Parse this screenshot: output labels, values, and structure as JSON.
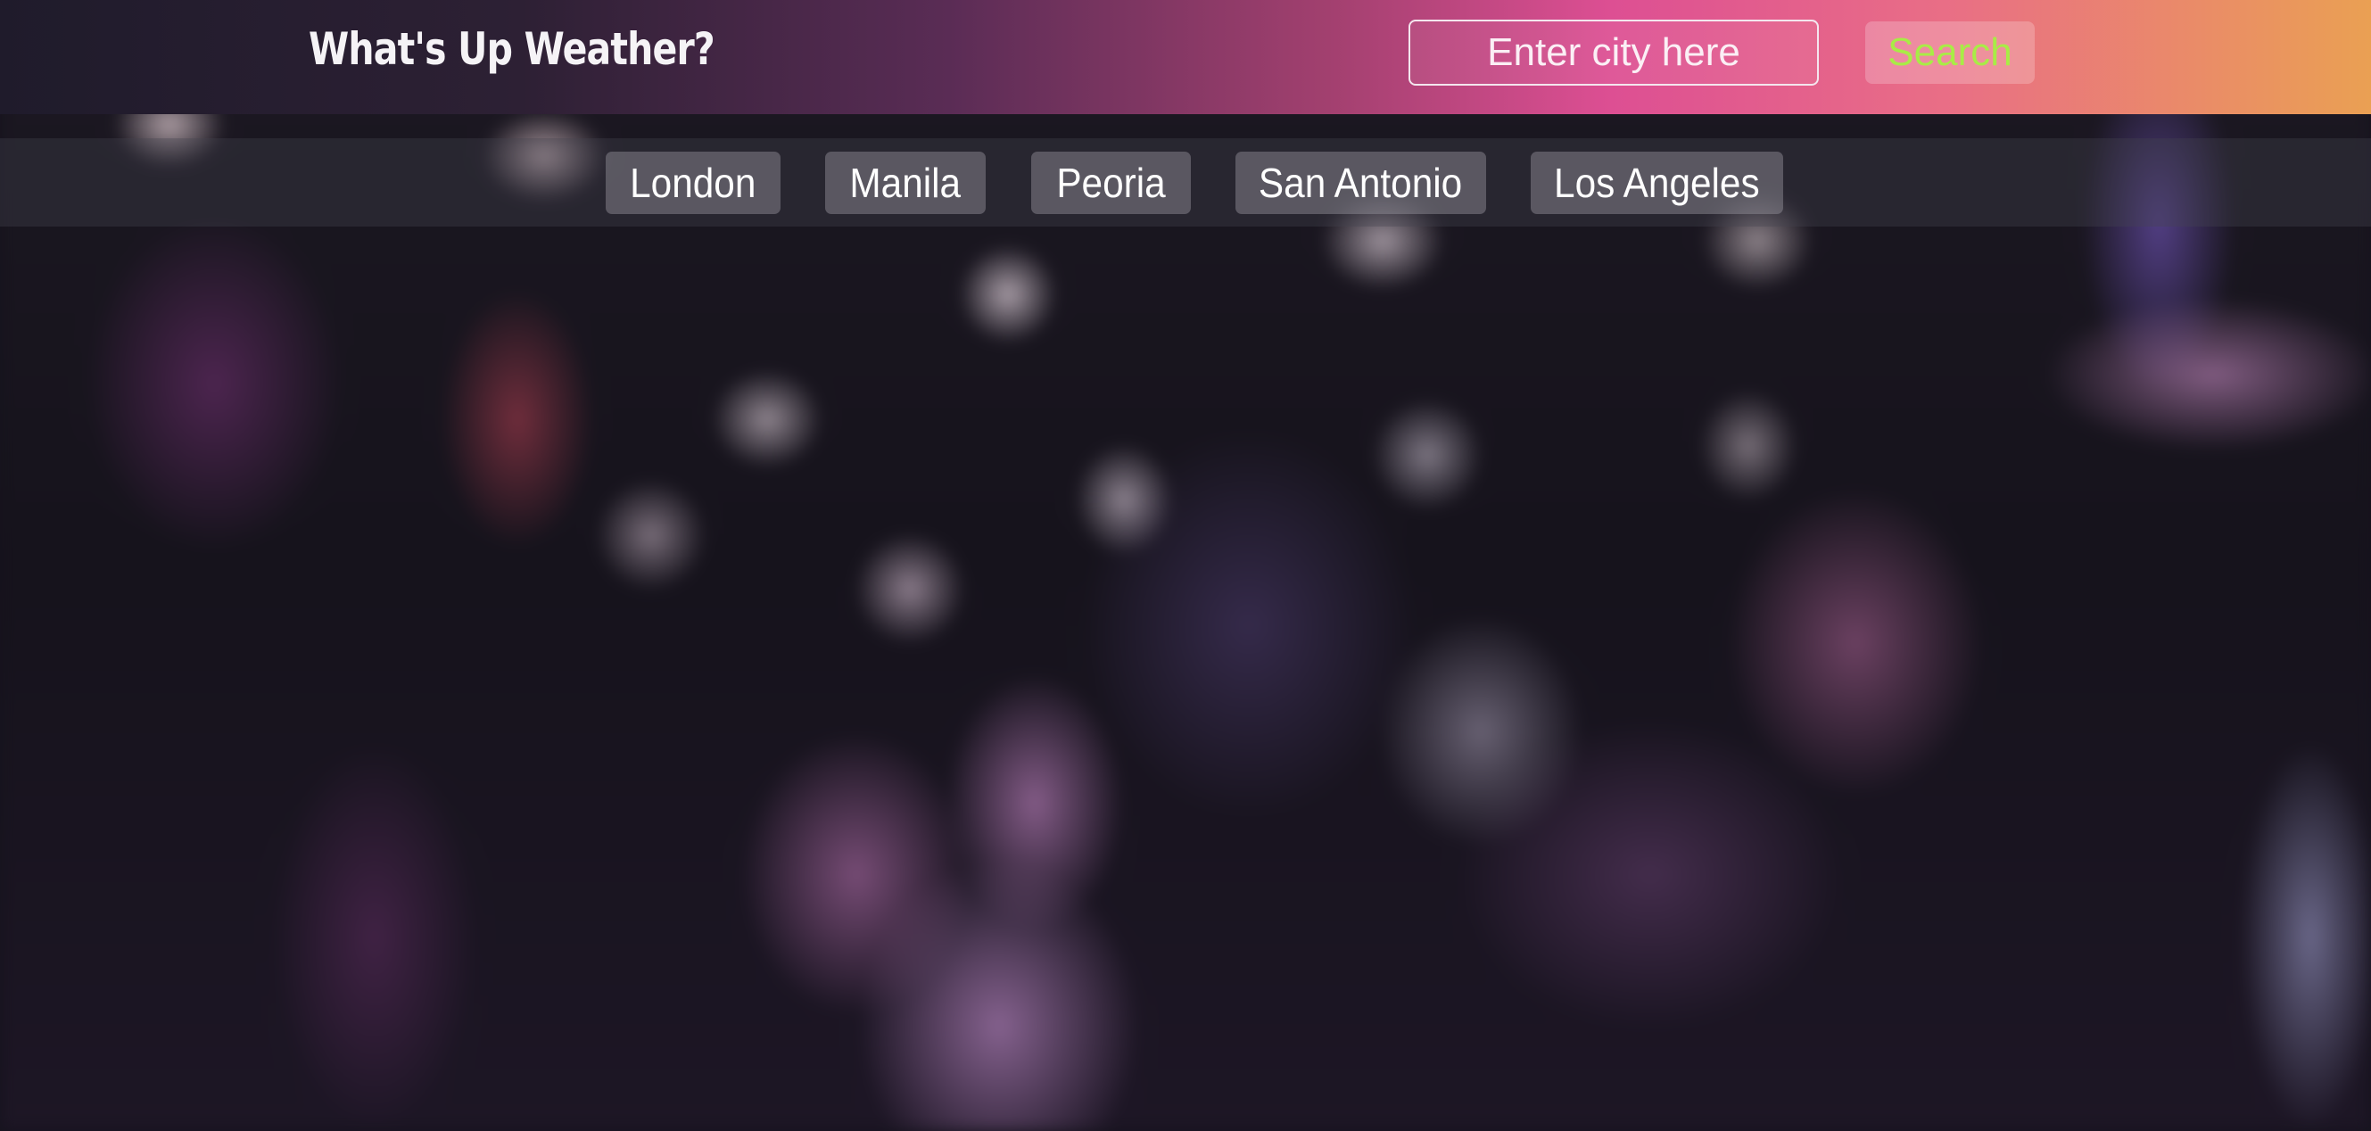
{
  "header": {
    "title": "What's Up Weather?",
    "search": {
      "placeholder": "Enter city here",
      "value": "",
      "button_label": "Search"
    }
  },
  "cities": [
    {
      "label": "London"
    },
    {
      "label": "Manila"
    },
    {
      "label": "Peoria"
    },
    {
      "label": "San Antonio"
    },
    {
      "label": "Los Angeles"
    }
  ],
  "colors": {
    "header_gradient": [
      "#1f1b2b",
      "#a2406f",
      "#dd4f93",
      "#eaa053"
    ],
    "search_button_text": "#a8ec46",
    "text": "#ffffff"
  }
}
